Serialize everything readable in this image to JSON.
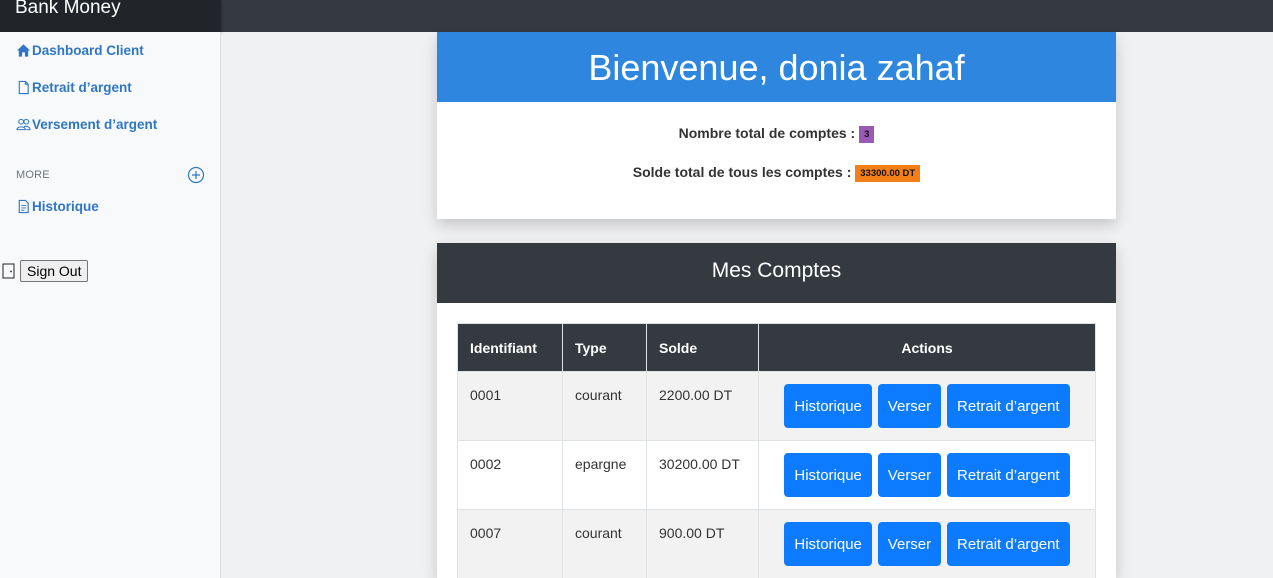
{
  "brand": {
    "title": "Bank Money"
  },
  "sidebar": {
    "items": [
      {
        "label": "Dashboard Client",
        "icon": "house-icon"
      },
      {
        "label": "Retrait d’argent",
        "icon": "file-icon"
      },
      {
        "label": "Versement d’argent",
        "icon": "people-icon"
      }
    ],
    "more_heading": "MORE",
    "more_items": [
      {
        "label": "Historique",
        "icon": "file-text-icon"
      }
    ],
    "signout_label": "Sign Out"
  },
  "welcome": {
    "title": "Bienvenue, donia zahaf",
    "accounts_count_label": "Nombre total de comptes :",
    "accounts_count": "3",
    "total_balance_label": "Solde total de tous les comptes :",
    "total_balance": "33300.00 DT"
  },
  "accounts": {
    "title": "Mes Comptes",
    "headers": [
      "Identifiant",
      "Type",
      "Solde",
      "Actions"
    ],
    "rows": [
      {
        "id": "0001",
        "type": "courant",
        "solde": "2200.00 DT"
      },
      {
        "id": "0002",
        "type": "epargne",
        "solde": "30200.00 DT"
      },
      {
        "id": "0007",
        "type": "courant",
        "solde": "900.00 DT"
      }
    ],
    "actions": {
      "history": "Historique",
      "deposit": "Verser",
      "withdraw": "Retrait d’argent"
    }
  },
  "colors": {
    "topbar": "#343a40",
    "brand_bg": "#212529",
    "welcome_header": "#2e86de",
    "primary_button": "#0d7bff",
    "badge_count": "#9b59b6",
    "badge_balance": "#f57f17",
    "sidebar_link": "#2f77c6"
  }
}
